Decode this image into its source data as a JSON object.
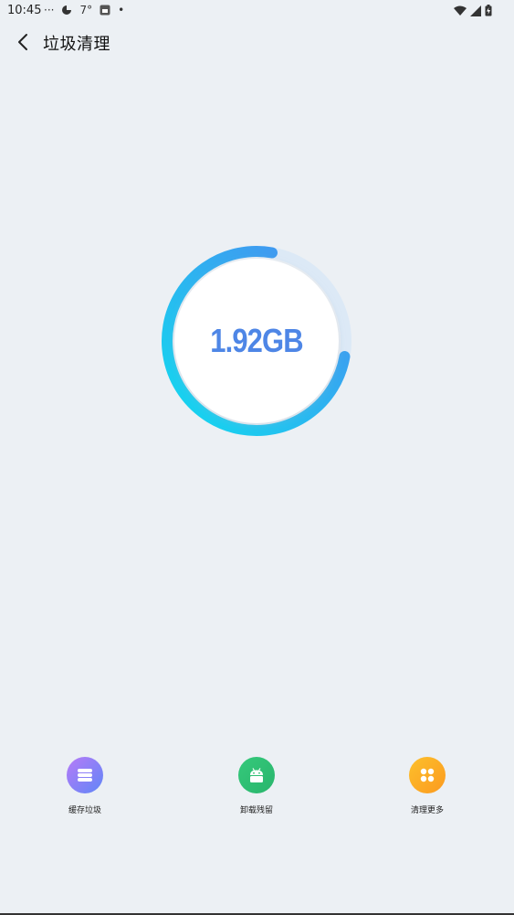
{
  "status_bar": {
    "time": "10:45",
    "dots": "···",
    "temperature": "7°",
    "dot": "•"
  },
  "header": {
    "title": "垃圾清理"
  },
  "gauge": {
    "value_text": "1.92GB",
    "progress": 0.75,
    "track_color": "#DCE9F6",
    "start_color": "#11DBEF",
    "end_color": "#4A8BF0"
  },
  "actions": [
    {
      "label": "缓存垃圾",
      "icon": "list-icon",
      "color_from": "#B77BF7",
      "color_to": "#5F86F7"
    },
    {
      "label": "卸载残留",
      "icon": "android-icon",
      "color_from": "#35C97B",
      "color_to": "#29B56C"
    },
    {
      "label": "清理更多",
      "icon": "apps-icon",
      "color_from": "#FDC02C",
      "color_to": "#FB9A1F"
    }
  ]
}
